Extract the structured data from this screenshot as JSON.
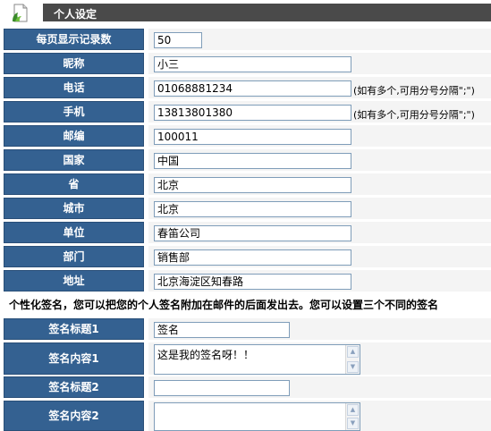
{
  "title": "个人设定",
  "fields": [
    {
      "label": "每页显示记录数",
      "value": "50"
    },
    {
      "label": "昵称",
      "value": "小三"
    },
    {
      "label": "电话",
      "value": "01068881234",
      "hint": "(如有多个,可用分号分隔\";\")"
    },
    {
      "label": "手机",
      "value": "13813801380",
      "hint": "(如有多个,可用分号分隔\";\")"
    },
    {
      "label": "邮编",
      "value": "100011"
    },
    {
      "label": "国家",
      "value": "中国"
    },
    {
      "label": "省",
      "value": "北京"
    },
    {
      "label": "城市",
      "value": "北京"
    },
    {
      "label": "单位",
      "value": "春笛公司"
    },
    {
      "label": "部门",
      "value": "销售部"
    },
    {
      "label": "地址",
      "value": "北京海淀区知春路"
    }
  ],
  "signature_note": "个性化签名，您可以把您的个人签名附加在邮件的后面发出去。您可以设置三个不同的签名",
  "signatures": [
    {
      "title_label": "签名标题1",
      "title_value": "签名",
      "content_label": "签名内容1",
      "content_value": "这是我的签名呀！！"
    },
    {
      "title_label": "签名标题2",
      "title_value": "",
      "content_label": "签名内容2",
      "content_value": ""
    }
  ],
  "icons": {
    "title_icon": "settings-page-icon",
    "scroll_up": "scroll-up-icon",
    "scroll_down": "scroll-down-icon"
  }
}
